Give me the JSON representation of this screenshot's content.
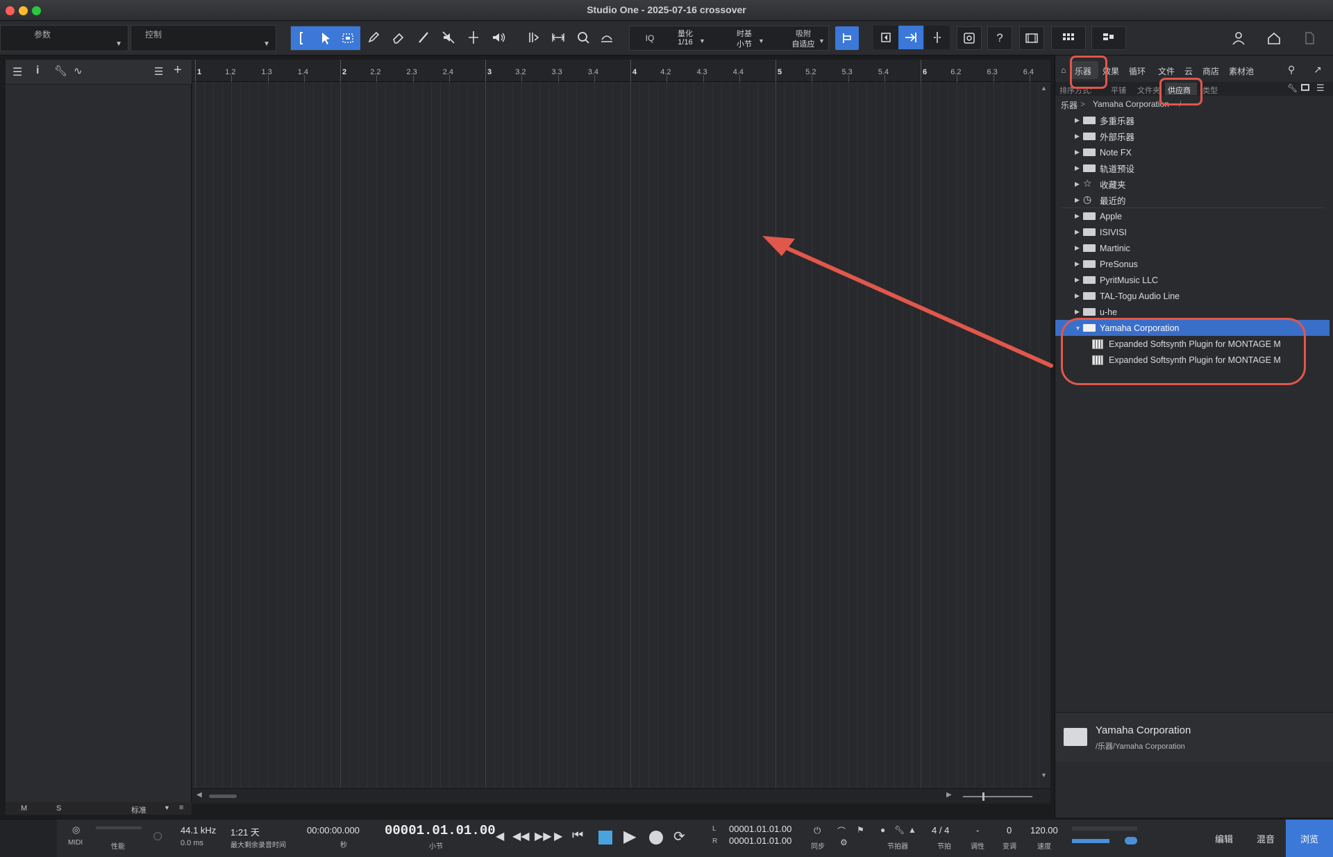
{
  "window": {
    "title": "Studio One - 2025-07-16 crossover"
  },
  "toolbar": {
    "params_label": "参数",
    "control_label": "控制",
    "iq_label": "IQ",
    "quantize": {
      "label": "量化",
      "value": "1/16"
    },
    "timebase": {
      "label": "时基",
      "value": "小节"
    },
    "snap": {
      "label": "吸附",
      "value": "自适应"
    },
    "help_label": "?"
  },
  "ruler": {
    "labels": [
      "1",
      "1.2",
      "1.3",
      "1.4",
      "2",
      "2.2",
      "2.3",
      "2.4",
      "3",
      "3.2",
      "3.3",
      "3.4",
      "4",
      "4.2",
      "4.3",
      "4.4",
      "5",
      "5.2",
      "5.3",
      "5.4",
      "6",
      "6.2",
      "6.3",
      "6.4"
    ]
  },
  "leftpanel": {
    "bottom": {
      "m": "M",
      "s": "S",
      "mode": "标准"
    }
  },
  "browser": {
    "tabs": [
      "乐器",
      "效果",
      "循环",
      "文件",
      "云",
      "商店",
      "素材池"
    ],
    "sort_label": "排序方式:",
    "sort_options": [
      "平铺",
      "文件夹",
      "供应商",
      "类型"
    ],
    "breadcrumb": {
      "root": "乐器",
      "sep": ">",
      "current": "Yamaha Corporation",
      "sep2": "/"
    },
    "tree": [
      {
        "label": "多重乐器",
        "icon": "multi-instrument-icon"
      },
      {
        "label": "外部乐器",
        "icon": "external-instrument-icon"
      },
      {
        "label": "Note FX",
        "icon": "folder-icon"
      },
      {
        "label": "轨道预设",
        "icon": "track-preset-icon"
      },
      {
        "label": "收藏夹",
        "icon": "star-icon"
      },
      {
        "label": "最近的",
        "icon": "clock-icon"
      },
      {
        "label": "Apple",
        "icon": "folder-icon"
      },
      {
        "label": "ISIVISI",
        "icon": "folder-icon"
      },
      {
        "label": "Martinic",
        "icon": "folder-icon"
      },
      {
        "label": "PreSonus",
        "icon": "presonus-icon"
      },
      {
        "label": "PyritMusic LLC",
        "icon": "folder-icon"
      },
      {
        "label": "TAL-Togu Audio Line",
        "icon": "folder-icon"
      },
      {
        "label": "u-he",
        "icon": "folder-icon"
      },
      {
        "label": "Yamaha Corporation",
        "icon": "open-folder-icon",
        "selected": true
      },
      {
        "label": "Expanded Softsynth Plugin for MONTAGE M",
        "icon": "keyboard-icon",
        "child": true
      },
      {
        "label": "Expanded Softsynth Plugin for MONTAGE M",
        "icon": "keyboard-icon",
        "child": true
      }
    ],
    "info": {
      "title": "Yamaha Corporation",
      "path": "/乐器/Yamaha Corporation"
    }
  },
  "transport": {
    "midi": "MIDI",
    "performance": "性能",
    "sample_rate": "44.1 kHz",
    "latency": "0.0 ms",
    "record_time": "1:21 天",
    "record_time_label": "最大剩余录音时间",
    "time_secs": "00:00:00.000",
    "time_secs_unit": "秒",
    "position": "00001.01.01.00",
    "position_unit": "小节",
    "loop_l_label": "L",
    "loop_r_label": "R",
    "loop_start": "00001.01.01.00",
    "loop_end": "00001.01.01.00",
    "sync": "同步",
    "metronome": "节拍器",
    "signature": "4 / 4",
    "signature_label": "节拍",
    "key": "-",
    "key_label": "调性",
    "transpose": "0",
    "transpose_label": "变调",
    "tempo": "120.00",
    "tempo_label": "速度",
    "views": [
      "编辑",
      "混音",
      "浏览"
    ]
  },
  "colors": {
    "accent": "#3b78d8",
    "selection": "#3a6fc9",
    "annotation": "#e2574c"
  }
}
